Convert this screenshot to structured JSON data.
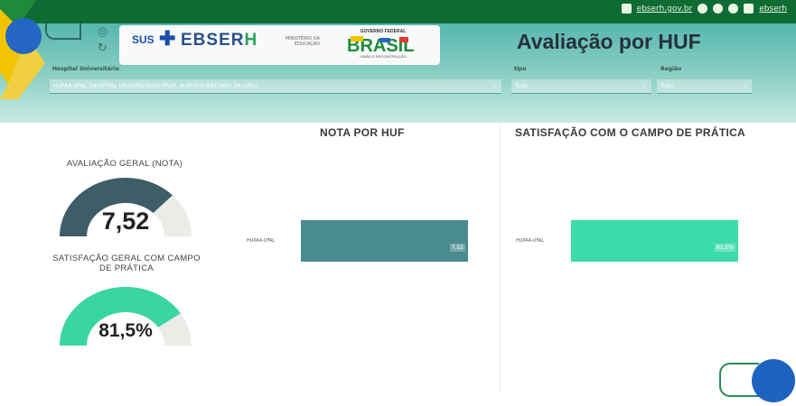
{
  "topbar": {
    "site_link": "ebserh.gov.br",
    "account_link": "ebserh",
    "icons": [
      "home-icon",
      "instagram-icon",
      "facebook-icon",
      "youtube-icon",
      "social-icon"
    ]
  },
  "header": {
    "title": "Avaliação por HUF",
    "logo_sus": "SUS",
    "logo_ebserh_main": "EBSER",
    "logo_ebserh_h": "H",
    "logo_mec": "MINISTÉRIO DA EDUCAÇÃO",
    "logo_gov": "GOVERNO FEDERAL",
    "logo_brasil": "BRASIL",
    "logo_gov_sub": "UNIÃO E RECONSTRUÇÃO"
  },
  "filters": {
    "hospital": {
      "label": "Hospital Universitário",
      "value": "HUPAA-UFAL (HOSPITAL UNIVERSITÁRIO PROF. ALBERTO ANTUNES DA UFAL)"
    },
    "tipo": {
      "label": "tipo",
      "value": "Tudo"
    },
    "regiao": {
      "label": "Região",
      "value": "Tudo"
    }
  },
  "gauges": [
    {
      "label": "AVALIAÇÃO GERAL (NOTA)",
      "value_text": "7,52",
      "fraction": 0.752,
      "color": "#3e5d66"
    },
    {
      "label": "SATISFAÇÃO GERAL COM CAMPO DE PRÁTICA",
      "value_text": "81,5%",
      "fraction": 0.815,
      "color": "#39d5a3"
    }
  ],
  "charts": {
    "nota": {
      "title": "NOTA POR HUF",
      "category": "HUPAA-UFAL",
      "value_label": "7,52",
      "color": "#4a8b8f"
    },
    "satisfacao": {
      "title": "SATISFAÇÃO COM O CAMPO DE PRÁTICA",
      "category": "HUPAA-UFAL",
      "value_label": "81,5%",
      "color": "#3cdba9"
    }
  },
  "colors": {
    "topbar": "#0f6b34",
    "header_teal": "#57b7ae",
    "gauge_track": "#ecebe7"
  }
}
